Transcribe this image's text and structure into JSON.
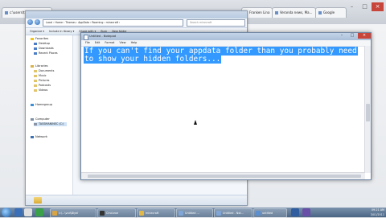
{
  "browser": {
    "tabs": [
      {
        "label": "c:\\users\\thy"
      },
      {
        "label": ""
      },
      {
        "label": ""
      },
      {
        "label": "Franken Lina"
      },
      {
        "label": "Veranda news, Ma..."
      },
      {
        "label": "Google"
      }
    ]
  },
  "explorer": {
    "address": "Local › Home › Thomas › AppData › Roaming › minecraft ›",
    "search_placeholder": "Search minecraft",
    "toolbar": [
      "Organize ▾",
      "Include in library ▾",
      "Share with ▾",
      "Burn",
      "New folder"
    ],
    "nav": {
      "favorites_header": "Favorites",
      "favorites": [
        "Desktop",
        "Downloads",
        "Recent Places"
      ],
      "libraries_header": "Libraries",
      "libraries": [
        "Documents",
        "Music",
        "Pictures",
        "Podcasts",
        "Videos"
      ],
      "homegroup": "Homegroup",
      "computer_header": "Computer",
      "drive": "TASSMANINEC (C:)",
      "network": "Network"
    },
    "status_item": "Computer"
  },
  "notepad": {
    "title": "Untitled - Notepad",
    "menu": [
      "File",
      "Edit",
      "Format",
      "View",
      "Help"
    ],
    "text_line1": "If you can't find your appdata folder than you probably need",
    "text_line2": "to show your hidden folders..."
  },
  "taskbar": {
    "items": [
      {
        "label": "c:\\...\\vcd\\Blyel",
        "color": "#d9a441"
      },
      {
        "label": "Cmd.exe",
        "color": "#333333"
      },
      {
        "label": "minecraft",
        "color": "#e0b84a"
      },
      {
        "label": "Untitled ...",
        "color": "#7fa6d6"
      },
      {
        "label": "Untitled - Not...",
        "color": "#7fa6d6"
      },
      {
        "label": "untitled",
        "color": "#5b8fd0"
      }
    ],
    "time": "09:21 AM",
    "date": "3/01/2011"
  },
  "icons": {
    "start": "windows-start-icon",
    "nav_back": "back-arrow-icon",
    "nav_forward": "forward-arrow-icon"
  }
}
